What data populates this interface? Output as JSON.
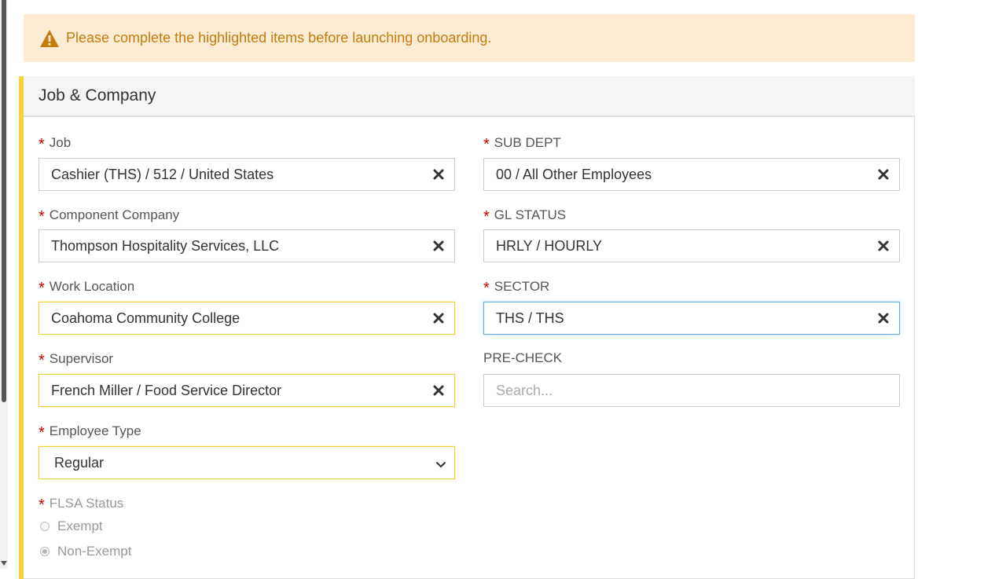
{
  "alert": {
    "icon": "warning-triangle-icon",
    "message": "Please complete the highlighted items before launching onboarding.",
    "color": "#c27d0e",
    "background": "#fdebd3"
  },
  "panel": {
    "title": "Job & Company",
    "accent_color": "#f7d33a"
  },
  "left_fields": [
    {
      "label": "Job",
      "required": true,
      "value": "Cashier (THS) / 512 / United States"
    },
    {
      "label": "Component Company",
      "required": true,
      "value": "Thompson Hospitality Services, LLC"
    },
    {
      "label": "Work Location",
      "required": true,
      "value": "Coahoma Community College"
    },
    {
      "label": "Supervisor",
      "required": true,
      "value": "French Miller / Food Service Director"
    },
    {
      "label": "Employee Type",
      "required": true,
      "value": "Regular"
    }
  ],
  "right_fields": [
    {
      "label": "SUB DEPT",
      "required": true,
      "value": "00 / All Other Employees"
    },
    {
      "label": "GL STATUS",
      "required": true,
      "value": "HRLY / HOURLY"
    },
    {
      "label": "SECTOR",
      "required": true,
      "value": "THS / THS"
    },
    {
      "label": "PRE-CHECK",
      "required": false,
      "placeholder": "Search..."
    }
  ],
  "flsa": {
    "label": "FLSA Status",
    "required": true,
    "options": [
      "Exempt",
      "Non-Exempt"
    ],
    "selected": "Non-Exempt"
  },
  "required_marker": "*"
}
